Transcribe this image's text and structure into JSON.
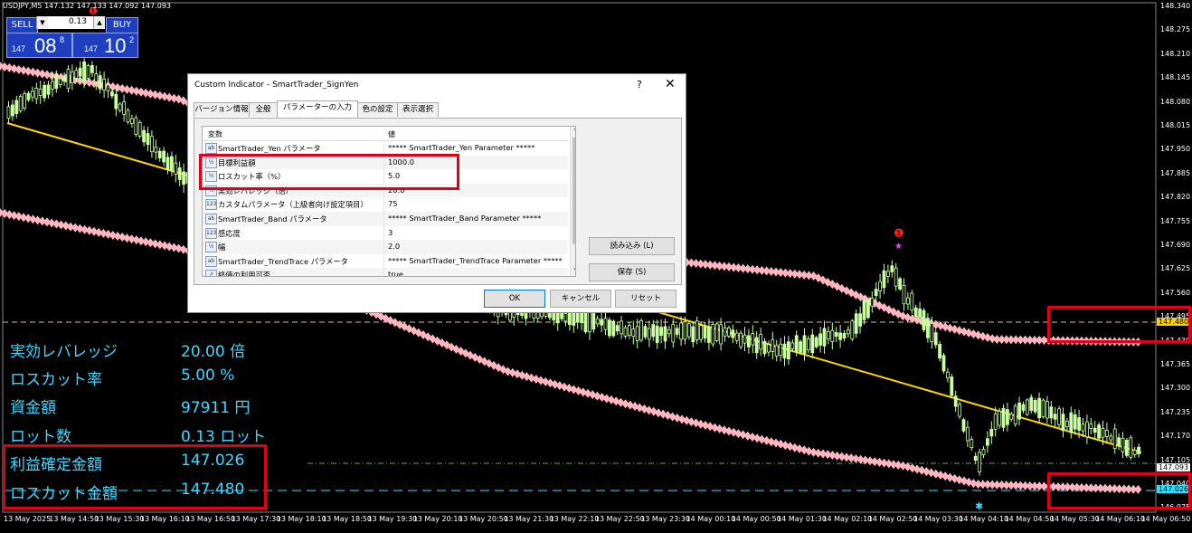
{
  "chart_title": "USDJPY,M5  147.132 147.133 147.092 147.093",
  "trade_panel": {
    "sell_label": "SELL",
    "buy_label": "BUY",
    "lot_value": "0.13",
    "sell_price_prefix": "147",
    "sell_price_main": "08",
    "sell_price_sup": "8",
    "buy_price_prefix": "147",
    "buy_price_main": "10",
    "buy_price_sup": "2"
  },
  "info_panel": [
    {
      "label": "実効レバレッジ",
      "value": "20.00 倍"
    },
    {
      "label": "ロスカット率",
      "value": "5.00 %"
    },
    {
      "label": "資金額",
      "value": "97911 円"
    },
    {
      "label": "ロット数",
      "value": "0.13 ロット"
    },
    {
      "label": "利益確定金額",
      "value": "147.026"
    },
    {
      "label": "ロスカット金額",
      "value": "147.480"
    }
  ],
  "y_axis": [
    "148.340",
    "148.275",
    "148.210",
    "148.145",
    "148.080",
    "148.015",
    "147.950",
    "147.885",
    "147.820",
    "147.755",
    "147.690",
    "147.625",
    "147.560",
    "147.495",
    "147.430",
    "147.365",
    "147.300",
    "147.235",
    "147.170",
    "147.105",
    "147.040",
    "146.975"
  ],
  "price_tags": {
    "losscut": "147.480",
    "current": "147.093",
    "bid": "147.026"
  },
  "x_axis": [
    "13 May 2025",
    "13 May 14:50",
    "13 May 15:30",
    "13 May 16:10",
    "13 May 16:50",
    "13 May 17:30",
    "13 May 18:10",
    "13 May 18:50",
    "13 May 19:30",
    "13 May 20:10",
    "13 May 20:50",
    "13 May 21:30",
    "13 May 22:10",
    "13 May 22:50",
    "13 May 23:30",
    "14 May 00:10",
    "14 May 00:50",
    "14 May 01:30",
    "14 May 02:10",
    "14 May 02:50",
    "14 May 03:30",
    "14 May 04:10",
    "14 May 04:50",
    "14 May 05:30",
    "14 May 06:10",
    "14 May 06:50"
  ],
  "dialog": {
    "title": "Custom Indicator - SmartTrader_SignYen",
    "help": "?",
    "close": "✕",
    "tabs": [
      "バージョン情報",
      "全般",
      "パラメーターの入力",
      "色の設定",
      "表示選択"
    ],
    "col_variable": "変数",
    "col_value": "値",
    "rows": [
      {
        "icon": "ab",
        "name": "SmartTrader_Yen パラメータ",
        "value": "***** SmartTrader_Yen Parameter *****"
      },
      {
        "icon": "½",
        "name": "目標利益額",
        "value": "1000.0"
      },
      {
        "icon": "½",
        "name": "ロスカット率（%）",
        "value": "5.0"
      },
      {
        "icon": "½",
        "name": "実効レバレッジ（倍）",
        "value": "20.0"
      },
      {
        "icon": "123",
        "name": "カスタムパラメータ（上級者向け設定項目）",
        "value": "75"
      },
      {
        "icon": "ab",
        "name": "SmartTrader_Band パラメータ",
        "value": "***** SmartTrader_Band Parameter *****"
      },
      {
        "icon": "123",
        "name": "感応度",
        "value": "3"
      },
      {
        "icon": "½",
        "name": "幅",
        "value": "2.0"
      },
      {
        "icon": "ab",
        "name": "SmartTrader_TrendTrace パラメータ",
        "value": "***** SmartTrader_TrendTrace Parameter *****"
      },
      {
        "icon": "↗",
        "name": "終値の利用可否",
        "value": "true"
      }
    ],
    "load_button": "読み込み (L)",
    "save_button": "保存 (S)",
    "ok_button": "OK",
    "cancel_button": "キャンセル",
    "reset_button": "リセット"
  },
  "colors": {
    "band": "#ffb6c1",
    "trend": "#ffd700",
    "candle": "#c8ffa0",
    "info_text": "#3fd6ff",
    "highlight": "#e0001a"
  }
}
